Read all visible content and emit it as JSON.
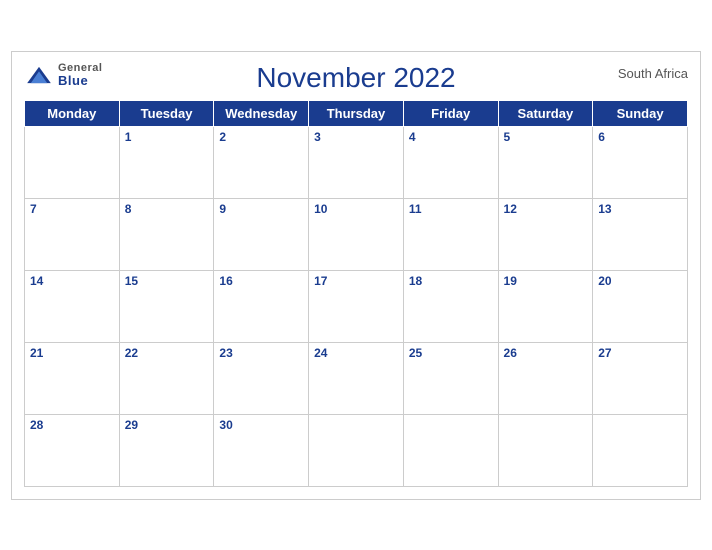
{
  "header": {
    "logo": {
      "general": "General",
      "blue": "Blue"
    },
    "title": "November 2022",
    "country": "South Africa"
  },
  "weekdays": [
    "Monday",
    "Tuesday",
    "Wednesday",
    "Thursday",
    "Friday",
    "Saturday",
    "Sunday"
  ],
  "weeks": [
    [
      null,
      1,
      2,
      3,
      4,
      5,
      6
    ],
    [
      7,
      8,
      9,
      10,
      11,
      12,
      13
    ],
    [
      14,
      15,
      16,
      17,
      18,
      19,
      20
    ],
    [
      21,
      22,
      23,
      24,
      25,
      26,
      27
    ],
    [
      28,
      29,
      30,
      null,
      null,
      null,
      null
    ]
  ]
}
